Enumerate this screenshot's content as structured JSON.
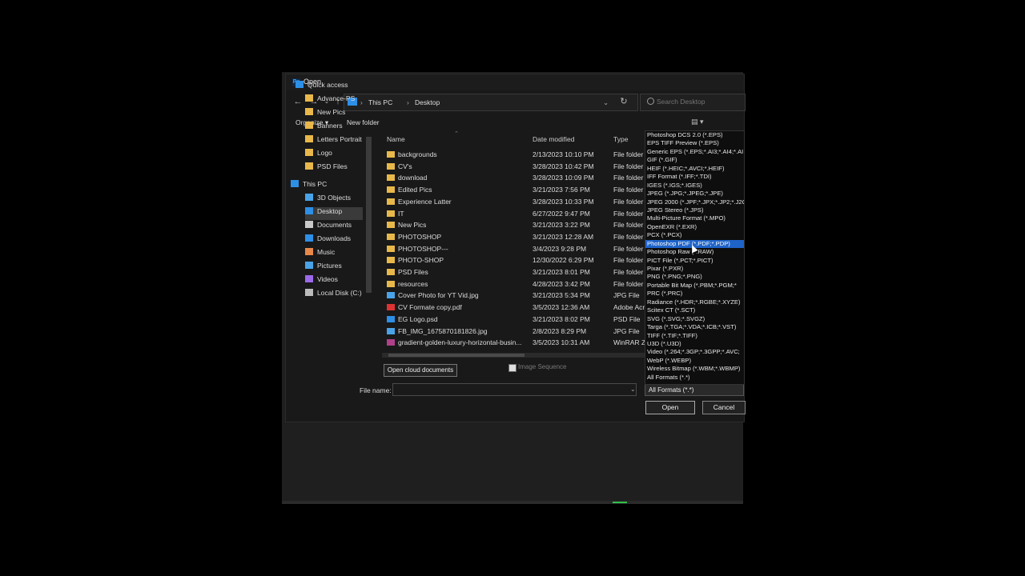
{
  "window": {
    "title": "Open",
    "app_icon": "Ps"
  },
  "address": {
    "crumbs": [
      "This PC",
      "Desktop"
    ],
    "search_placeholder": "Search Desktop"
  },
  "toolbar": {
    "organize": "Organize ▾",
    "new_folder": "New folder"
  },
  "nav": {
    "items": [
      {
        "label": "Quick access",
        "icon": "star-icon"
      },
      {
        "label": "Advance-PS",
        "icon": "folder-icon"
      },
      {
        "label": "New Pics",
        "icon": "folder-icon"
      },
      {
        "label": "Banners",
        "icon": "folder-icon"
      },
      {
        "label": "Letters Portrait",
        "icon": "folder-icon"
      },
      {
        "label": "Logo",
        "icon": "folder-icon"
      },
      {
        "label": "PSD Files",
        "icon": "folder-icon"
      },
      {
        "label": "This PC",
        "icon": "pc-icon"
      },
      {
        "label": "3D Objects",
        "icon": "cube-icon"
      },
      {
        "label": "Desktop",
        "icon": "desktop-icon"
      },
      {
        "label": "Documents",
        "icon": "documents-icon"
      },
      {
        "label": "Downloads",
        "icon": "download-icon"
      },
      {
        "label": "Music",
        "icon": "music-icon"
      },
      {
        "label": "Pictures",
        "icon": "pictures-icon"
      },
      {
        "label": "Videos",
        "icon": "videos-icon"
      },
      {
        "label": "Local Disk (C:)",
        "icon": "disk-icon"
      }
    ]
  },
  "columns": {
    "name": "Name",
    "date": "Date modified",
    "type": "Type"
  },
  "files": [
    {
      "name": "backgrounds",
      "date": "2/13/2023 10:10 PM",
      "type": "File folder",
      "kind": "folder"
    },
    {
      "name": "CV's",
      "date": "3/28/2023 10:42 PM",
      "type": "File folder",
      "kind": "folder"
    },
    {
      "name": "download",
      "date": "3/28/2023 10:09 PM",
      "type": "File folder",
      "kind": "folder"
    },
    {
      "name": "Edited Pics",
      "date": "3/21/2023 7:56 PM",
      "type": "File folder",
      "kind": "folder"
    },
    {
      "name": "Experience Latter",
      "date": "3/28/2023 10:33 PM",
      "type": "File folder",
      "kind": "folder"
    },
    {
      "name": "IT",
      "date": "6/27/2022 9:47 PM",
      "type": "File folder",
      "kind": "folder"
    },
    {
      "name": "New Pics",
      "date": "3/21/2023 3:22 PM",
      "type": "File folder",
      "kind": "folder"
    },
    {
      "name": "PHOTOSHOP",
      "date": "3/21/2023 12:28 AM",
      "type": "File folder",
      "kind": "folder"
    },
    {
      "name": "PHOTOSHOP---",
      "date": "3/4/2023 9:28 PM",
      "type": "File folder",
      "kind": "folder"
    },
    {
      "name": "PHOTO-SHOP",
      "date": "12/30/2022 6:29 PM",
      "type": "File folder",
      "kind": "folder"
    },
    {
      "name": "PSD Files",
      "date": "3/21/2023 8:01 PM",
      "type": "File folder",
      "kind": "folder"
    },
    {
      "name": "resources",
      "date": "4/28/2023 3:42 PM",
      "type": "File folder",
      "kind": "folder"
    },
    {
      "name": "Cover Photo for YT Vid.jpg",
      "date": "3/21/2023 5:34 PM",
      "type": "JPG File",
      "kind": "image"
    },
    {
      "name": "CV Formate copy.pdf",
      "date": "3/5/2023 12:36 AM",
      "type": "Adobe Acr",
      "kind": "pdf"
    },
    {
      "name": "EG Logo.psd",
      "date": "3/21/2023 8:02 PM",
      "type": "PSD File",
      "kind": "psd"
    },
    {
      "name": "FB_IMG_1675870181826.jpg",
      "date": "2/8/2023 8:29 PM",
      "type": "JPG File",
      "kind": "image"
    },
    {
      "name": "gradient-golden-luxury-horizontal-busin...",
      "date": "3/5/2023 10:31 AM",
      "type": "WinRAR ZI",
      "kind": "zip"
    }
  ],
  "bottom": {
    "cloud_button": "Open cloud documents",
    "image_sequence": "Image Sequence",
    "file_name_label": "File name:",
    "file_name_value": "",
    "selected_format": "All Formats (*.*)",
    "open": "Open",
    "cancel": "Cancel"
  },
  "formats": [
    "Photoshop DCS 2.0 (*.EPS)",
    "EPS TIFF Preview (*.EPS)",
    "Generic EPS (*.EPS;*.AI3;*.AI4;*.AI",
    "GIF (*.GIF)",
    "HEIF (*.HEIC;*.AVCI;*.HEIF)",
    "IFF Format (*.IFF;*.TDI)",
    "IGES (*.IGS;*.IGES)",
    "JPEG (*.JPG;*.JPEG;*.JPE)",
    "JPEG 2000 (*.JPF;*.JPX;*.JP2;*.J2C",
    "JPEG Stereo (*.JPS)",
    "Multi-Picture Format (*.MPO)",
    "OpenEXR (*.EXR)",
    "PCX (*.PCX)",
    "Photoshop PDF (*.PDF;*.PDP)",
    "Photoshop Raw (*.RAW)",
    "PICT File (*.PCT;*.PICT)",
    "Pixar (*.PXR)",
    "PNG (*.PNG;*.PNG)",
    "Portable Bit Map (*.PBM;*.PGM;*",
    "PRC (*.PRC)",
    "Radiance (*.HDR;*.RGBE;*.XYZE)",
    "Scitex CT (*.SCT)",
    "SVG (*.SVG;*.SVGZ)",
    "Targa (*.TGA;*.VDA;*.ICB;*.VST)",
    "TIFF (*.TIF;*.TIFF)",
    "U3D (*.U3D)",
    "Video (*.264;*.3GP;*.3GPP;*.AVC;",
    "WebP (*.WEBP)",
    "Wireless Bitmap (*.WBM;*.WBMP)",
    "All Formats (*.*)"
  ],
  "highlighted_format_index": 13,
  "colors": {
    "highlight": "#1e63c8",
    "folder": "#e8b84a",
    "accent": "#2d8fe6"
  }
}
